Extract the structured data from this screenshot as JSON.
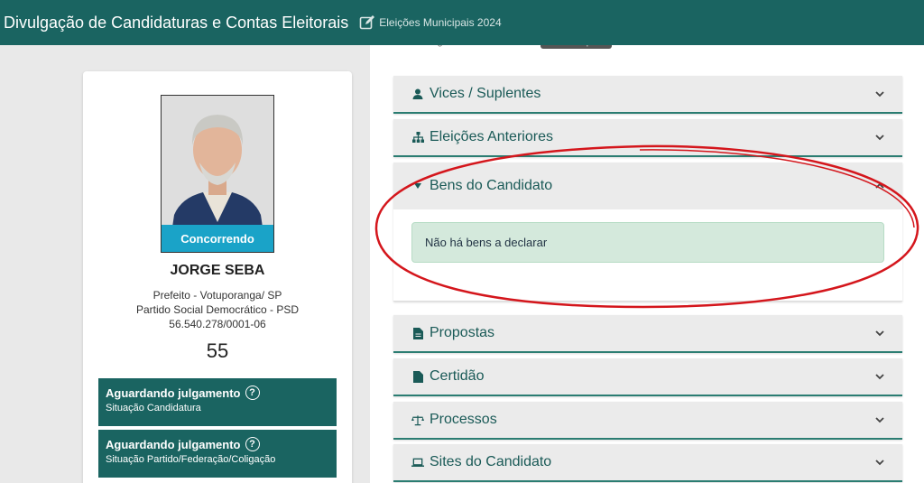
{
  "header": {
    "title": "Divulgação de Candidaturas e Contas Eleitorais",
    "election": "Eleições Municipais 2024"
  },
  "faded_bar": {
    "text": "Limite Legal de Gastos > Valor",
    "tag": "Não se Aplica"
  },
  "candidate": {
    "status": "Concorrendo",
    "name": "JORGE SEBA",
    "office": "Prefeito - Votuporanga/ SP",
    "party": "Partido Social Democrático - PSD",
    "cnpj": "56.540.278/0001-06",
    "number": "55",
    "situations": [
      {
        "main": "Aguardando julgamento",
        "sub": "Situação Candidatura"
      },
      {
        "main": "Aguardando julgamento",
        "sub": "Situação Partido/Federação/Coligação"
      }
    ]
  },
  "sections": {
    "vices": "Vices / Suplentes",
    "previous": "Eleições Anteriores",
    "assets": "Bens do Candidato",
    "assets_message": "Não há bens a declarar",
    "proposals": "Propostas",
    "certificate": "Certidão",
    "processes": "Processos",
    "sites": "Sites do Candidato"
  },
  "colors": {
    "header_bg": "#1a6461",
    "status_pill": "#1aa3c8",
    "annotation": "#d4161c"
  }
}
